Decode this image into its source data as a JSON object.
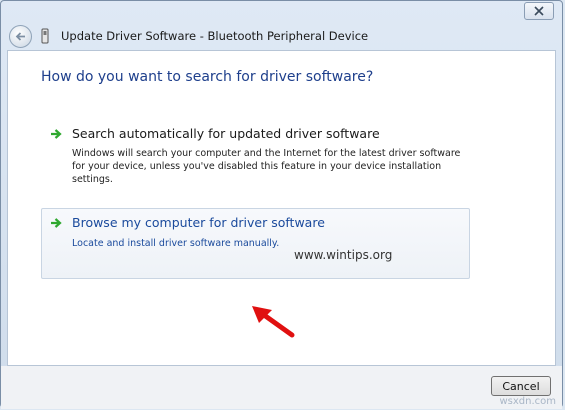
{
  "window": {
    "title": "Update Driver Software - Bluetooth Peripheral Device",
    "close_icon": "close-icon",
    "back_icon": "back-arrow-icon",
    "device_icon": "device-icon"
  },
  "main": {
    "heading": "How do you want to search for driver software?",
    "options": [
      {
        "icon": "green-arrow-icon",
        "title": "Search automatically for updated driver software",
        "description": "Windows will search your computer and the Internet for the latest driver software for your device, unless you've disabled this feature in your device installation settings."
      },
      {
        "icon": "green-arrow-icon",
        "title": "Browse my computer for driver software",
        "description": "Locate and install driver software manually."
      }
    ]
  },
  "overlay": {
    "watermark": "www.wintips.org",
    "corner_tag": "wsxdn.com",
    "pointer_icon": "red-pointer-arrow-icon"
  },
  "footer": {
    "cancel_label": "Cancel"
  },
  "colors": {
    "heading": "#1e3f8c",
    "link": "#1a4a9c",
    "arrow_green": "#2fa82f",
    "pointer_red": "#e01010"
  }
}
